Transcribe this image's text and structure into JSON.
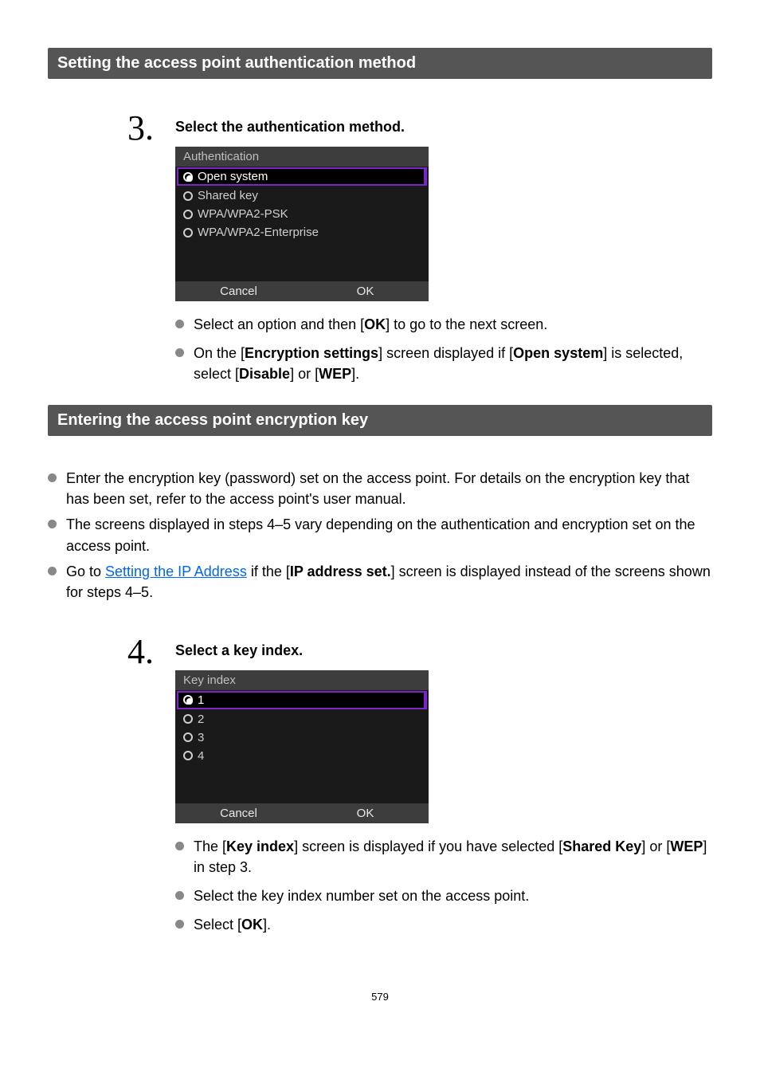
{
  "page_number": "579",
  "section1": {
    "banner": "Setting the access point authentication method",
    "step_num": "3.",
    "step_title": "Select the authentication method.",
    "screen": {
      "header": "Authentication",
      "options": [
        "Open system",
        "Shared key",
        "WPA/WPA2-PSK",
        "WPA/WPA2-Enterprise"
      ],
      "cancel": "Cancel",
      "ok": "OK"
    },
    "bullets": {
      "b1_pre": "Select an option and then [",
      "b1_ok": "OK",
      "b1_post": "] to go to the next screen.",
      "b2_pre": "On the [",
      "b2_enc": "Encryption settings",
      "b2_mid": "] screen displayed if [",
      "b2_open": "Open system",
      "b2_mid2": "] is selected, select [",
      "b2_dis": "Disable",
      "b2_or": "] or [",
      "b2_wep": "WEP",
      "b2_end": "]."
    }
  },
  "section2": {
    "banner": "Entering the access point encryption key",
    "bullets": {
      "b1": "Enter the encryption key (password) set on the access point. For details on the encryption key that has been set, refer to the access point's user manual.",
      "b2": "The screens displayed in steps 4–5 vary depending on the authentication and encryption set on the access point.",
      "b3_pre": "Go to ",
      "b3_link": "Setting the IP Address",
      "b3_mid": " if the [",
      "b3_ip": "IP address set.",
      "b3_post": "] screen is displayed instead of the screens shown for steps 4–5."
    },
    "step_num": "4.",
    "step_title": "Select a key index.",
    "screen": {
      "header": "Key index",
      "options": [
        "1",
        "2",
        "3",
        "4"
      ],
      "cancel": "Cancel",
      "ok": "OK"
    },
    "sbullets": {
      "b1_pre": "The [",
      "b1_ki": "Key index",
      "b1_mid": "] screen is displayed if you have selected [",
      "b1_sk": "Shared Key",
      "b1_or": "] or [",
      "b1_wep": "WEP",
      "b1_post": "] in step 3.",
      "b2": "Select the key index number set on the access point.",
      "b3_pre": "Select [",
      "b3_ok": "OK",
      "b3_post": "]."
    }
  }
}
